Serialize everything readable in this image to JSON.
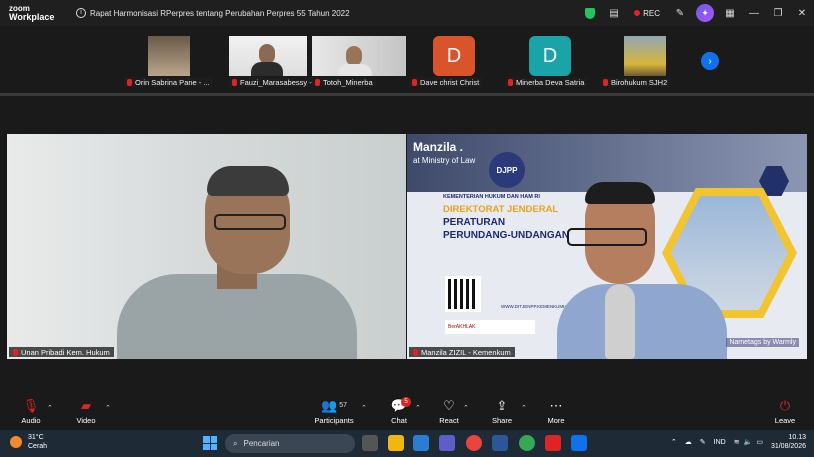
{
  "app": {
    "brand_top": "zoom",
    "brand_bottom": "Workplace"
  },
  "meeting": {
    "title": "Rapat Harmonisasi RPerpres tentang Perubahan Perpres 55 Tahun 2022"
  },
  "titlebar": {
    "rec_label": "REC"
  },
  "participants_strip": [
    {
      "name": "Orin Sabrina Pane - ..."
    },
    {
      "name": "Fauzi_Marasabessy - ..."
    },
    {
      "name": "Totoh_Minerba"
    },
    {
      "name": "Dave christ Christ",
      "initial": "D",
      "color": "#d9542b"
    },
    {
      "name": "Minerba Deva Satria",
      "initial": "D",
      "color": "#1ba4a8"
    },
    {
      "name": "Birohukum SJH2"
    }
  ],
  "main_videos": {
    "left": {
      "label": "Unan Pribadi Kem. Hukum"
    },
    "right": {
      "label": "Manzila ZIZIL - Kemenkum",
      "overlay_name": "Manzila .",
      "overlay_sub": "at Ministry of Law",
      "logo_text": "DJPP",
      "banner_line1": "KEMENTERIAN HUKUM DAN HAM RI",
      "banner_line2": "DIREKTORAT JENDERAL",
      "banner_line3": "PERATURAN",
      "banner_line4": "PERUNDANG-UNDANGAN",
      "banner_url": "WWW.DITJENPP.KEMENKUMHAM.GO.ID",
      "badge_text": "BerAKHLAK",
      "watermark": "Nametags by Warmly"
    }
  },
  "controls": {
    "audio": "Audio",
    "video": "Video",
    "participants": "Participants",
    "participants_count": "57",
    "chat": "Chat",
    "chat_badge": "5",
    "react": "React",
    "share": "Share",
    "more": "More",
    "leave": "Leave"
  },
  "taskbar": {
    "weather_temp": "31°C",
    "weather_desc": "Cerah",
    "search_placeholder": "Pencarian",
    "lang": "IND",
    "time": "10.13",
    "date": "31/08/2026"
  }
}
